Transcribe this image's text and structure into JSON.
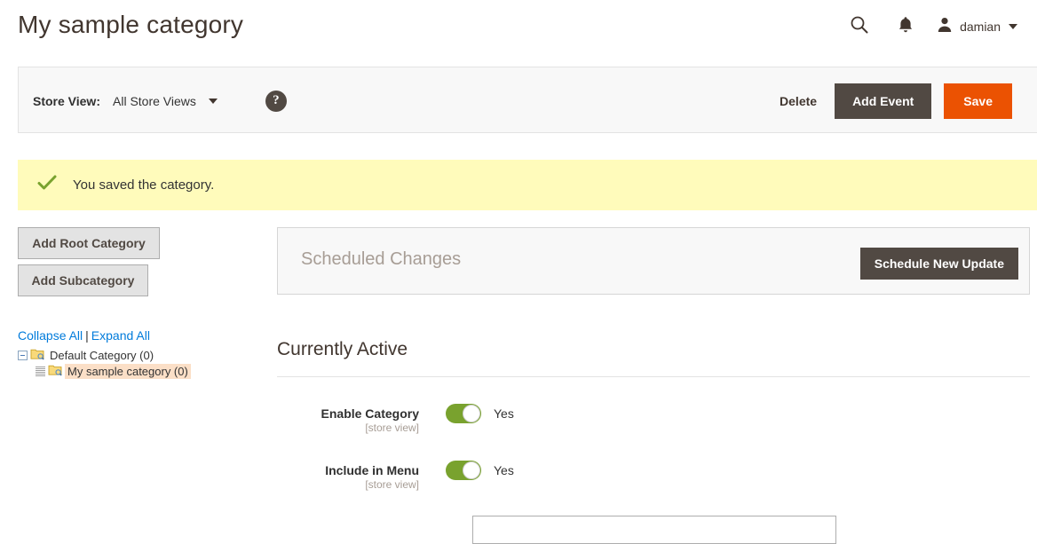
{
  "header": {
    "title": "My sample category",
    "search_icon": "search-icon",
    "notifications_icon": "bell-icon",
    "user_icon": "user-avatar-icon",
    "user_name": "damian",
    "caret_icon": "chevron-down-icon"
  },
  "toolbar": {
    "store_view_label": "Store View:",
    "store_view_value": "All Store Views",
    "store_view_caret": "chevron-down-icon",
    "help_icon_label": "?",
    "delete_label": "Delete",
    "add_event_label": "Add Event",
    "save_label": "Save"
  },
  "message": {
    "icon": "check-icon",
    "text": "You saved the category."
  },
  "sidebar": {
    "add_root_label": "Add Root Category",
    "add_subcategory_label": "Add Subcategory",
    "collapse_all_label": "Collapse All",
    "separator": "|",
    "expand_all_label": "Expand All",
    "tree": [
      {
        "label": "Default Category (0)",
        "selected": false,
        "icon": "folder-search-icon"
      },
      {
        "label": "My sample category (0)",
        "selected": true,
        "icon": "folder-search-icon"
      }
    ]
  },
  "scheduled_changes": {
    "title": "Scheduled Changes",
    "button_label": "Schedule New Update"
  },
  "main": {
    "section_title": "Currently Active",
    "fields": [
      {
        "label": "Enable Category",
        "scope": "[store view]",
        "toggle_state": "on",
        "toggle_text": "Yes"
      },
      {
        "label": "Include in Menu",
        "scope": "[store view]",
        "toggle_state": "on",
        "toggle_text": "Yes"
      }
    ],
    "category_name_value": "",
    "category_name_placeholder": ""
  },
  "colors": {
    "primary": "#eb5202",
    "dark": "#514943",
    "toggle_on": "#79a22e",
    "link": "#007bdb",
    "message_bg": "#fffbbb",
    "selected_node": "#fbdfc7"
  }
}
